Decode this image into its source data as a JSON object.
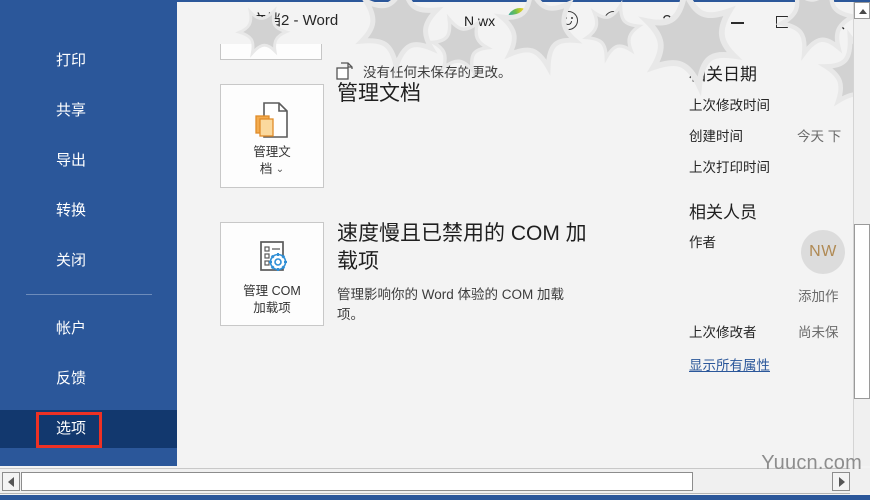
{
  "window": {
    "title": "文档2  -  Word",
    "help_label": "?",
    "minimize_label": "最小化",
    "maximize_label": "最大化",
    "close_label": "关闭",
    "tray_text": "N wx",
    "accent_color": "#2b579a",
    "sidebar_selected_color": "#12386e",
    "highlight_color": "#ee3124"
  },
  "sidebar": {
    "items": [
      {
        "label": "打印",
        "name": "print",
        "selected": false
      },
      {
        "label": "共享",
        "name": "share",
        "selected": false
      },
      {
        "label": "导出",
        "name": "export",
        "selected": false
      },
      {
        "label": "转换",
        "name": "transform",
        "selected": false
      },
      {
        "label": "关闭",
        "name": "close",
        "selected": false
      },
      {
        "label": "帐户",
        "name": "account",
        "selected": false
      },
      {
        "label": "反馈",
        "name": "feedback",
        "selected": false
      },
      {
        "label": "选项",
        "name": "options",
        "selected": true
      }
    ]
  },
  "main": {
    "tiles": [
      {
        "button_label": "管理文\n档",
        "icon": "manage-document-icon",
        "has_dropdown": true,
        "heading": "管理文档",
        "sub_icon": "unsaved-changes-icon",
        "sub_text": "没有任何未保存的更改。"
      },
      {
        "button_label": "管理 COM\n加载项",
        "icon": "com-addins-icon",
        "has_dropdown": false,
        "heading": "速度慢且已禁用的 COM 加载项",
        "sub_icon": "",
        "sub_text": "管理影响你的 Word 体验的 COM 加载项。"
      }
    ]
  },
  "properties": {
    "dates_heading": "相关日期",
    "dates": [
      {
        "label": "上次修改时间",
        "value": ""
      },
      {
        "label": "创建时间",
        "value": "今天 下"
      },
      {
        "label": "上次打印时间",
        "value": ""
      }
    ],
    "people_heading": "相关人员",
    "author_label": "作者",
    "author_initials": "NW",
    "add_author_label": "添加作",
    "last_modified_by_label": "上次修改者",
    "last_modified_by_value": "尚未保",
    "show_all_link": "显示所有属性"
  },
  "watermark": {
    "text": "Yuucn.com"
  },
  "scrollbars": {
    "vertical_up_label": "向上滚动",
    "horizontal_left_label": "向左滚动",
    "horizontal_right_label": "向右滚动"
  }
}
